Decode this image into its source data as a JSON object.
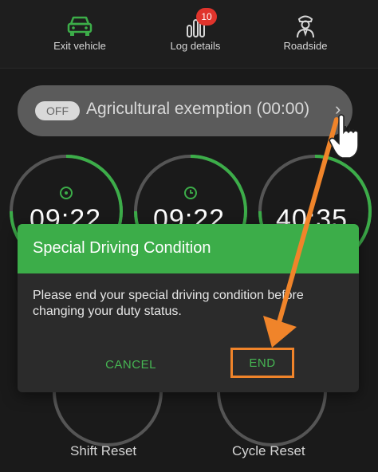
{
  "nav": {
    "items": [
      {
        "label": "Exit vehicle",
        "icon": "car-icon"
      },
      {
        "label": "Log details",
        "icon": "bar-chart-icon",
        "badge": "10"
      },
      {
        "label": "Roadside",
        "icon": "officer-icon"
      }
    ]
  },
  "condition": {
    "toggle": "OFF",
    "label": "Agricultural exemption (00:00)",
    "chevron": "›"
  },
  "gauges": [
    {
      "time": "09:22",
      "icon": "steering-wheel-icon"
    },
    {
      "time": "09:22",
      "icon": "clock-icon"
    },
    {
      "time": "40:35",
      "icon": ""
    }
  ],
  "dialog": {
    "title": "Special Driving Condition",
    "message": "Please end your special driving condition before changing your duty status.",
    "cancel": "CANCEL",
    "end": "END"
  },
  "bottom": {
    "shift_reset": "Shift Reset",
    "cycle_reset": "Cycle Reset"
  },
  "colors": {
    "accent_green": "#3cad49",
    "highlight_orange": "#f0842a",
    "badge_red": "#e0342c"
  }
}
